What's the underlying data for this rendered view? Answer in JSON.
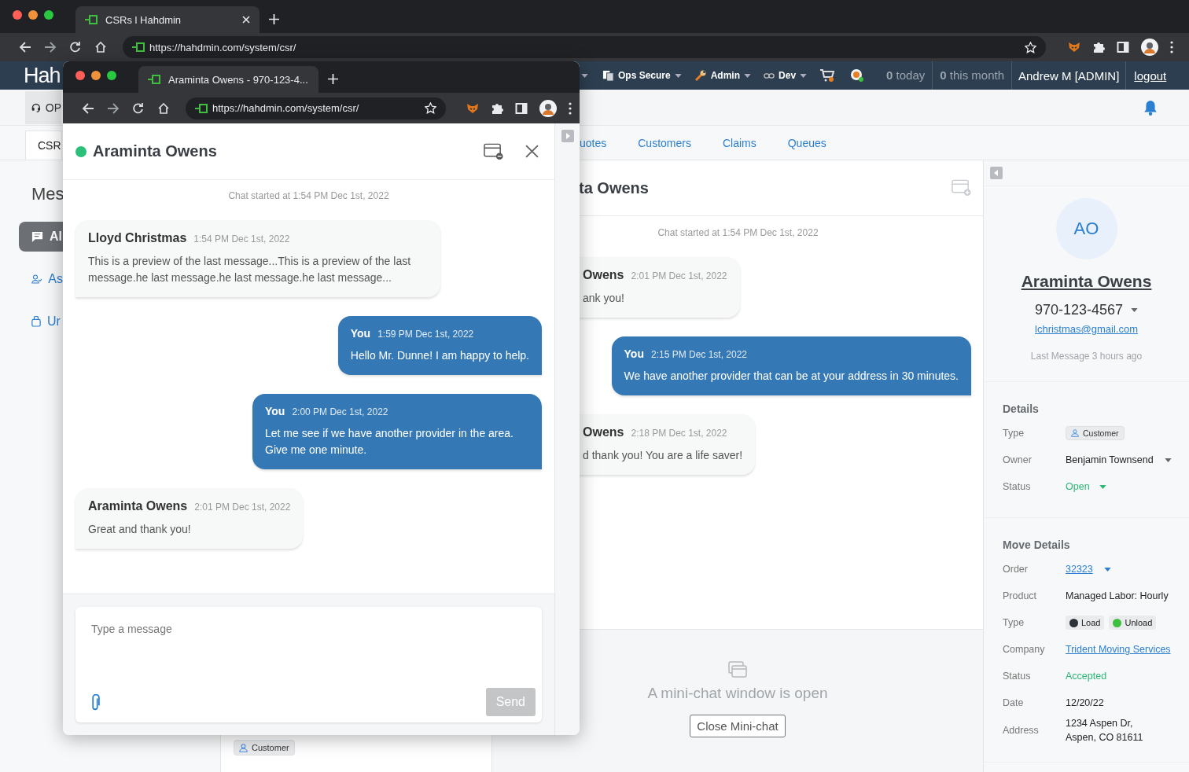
{
  "browser": {
    "tab_title": "CSRs l Hahdmin",
    "url": "https://hahdmin.com/system/csr/"
  },
  "app_header": {
    "logo": "Hah",
    "menus": [
      {
        "label": "Ops Secure",
        "kind": "documents"
      },
      {
        "label": "Admin",
        "kind": "wrench"
      },
      {
        "label": "Dev",
        "kind": "link"
      }
    ],
    "today": "**0** today",
    "month": "**0** this month",
    "user": "Andrew M [ADMIN]",
    "logout": "logout"
  },
  "toolbar": {
    "button": "OP"
  },
  "tabs": [
    {
      "label": "CSR",
      "selected": true
    },
    {
      "label": "uotes",
      "selected": false
    },
    {
      "label": "Customers",
      "selected": false
    },
    {
      "label": "Claims",
      "selected": false
    },
    {
      "label": "Queues",
      "selected": false
    }
  ],
  "sidebar": {
    "title": "Mes",
    "items": [
      {
        "label": "Al",
        "kind": "chat",
        "selected": true
      },
      {
        "label": "As",
        "kind": "person",
        "selected": false
      },
      {
        "label": "Ur",
        "kind": "bag",
        "selected": false
      }
    ]
  },
  "conversation_list": {
    "badge": "Customer"
  },
  "chat": {
    "title": "ta Owens",
    "started": "Chat started at 1:54 PM Dec 1st, 2022",
    "messages": [
      {
        "kind": "incoming",
        "author": "Owens",
        "time": "2:01 PM Dec 1st, 2022",
        "text": "ank you!"
      },
      {
        "kind": "outgoing",
        "author": "You",
        "time": "2:15 PM Dec 1st, 2022",
        "text": "We have another provider that can be at your address in 30 minutes."
      },
      {
        "kind": "incoming",
        "author": "Owens",
        "time": "2:18 PM Dec 1st, 2022",
        "text": "d thank you! You are a life saver!"
      }
    ],
    "notice": "A mini-chat window is open",
    "close_button": "Close Mini-chat"
  },
  "contact_panel": {
    "initials": "AO",
    "name": "Araminta Owens",
    "phone": "970-123-4567",
    "email": "lchristmas@gmail.com",
    "last_message": "Last Message 3 hours ago",
    "details": {
      "title": "Details",
      "rows": [
        {
          "label": "Type",
          "kind": "badge",
          "value": "Customer",
          "dropdown": false
        },
        {
          "label": "Owner",
          "kind": "text",
          "value": "Benjamin Townsend",
          "dropdown": true
        },
        {
          "label": "Status",
          "kind": "status",
          "value": "Open",
          "dropdown": true
        }
      ]
    },
    "move_details": {
      "title": "Move Details",
      "rows": [
        {
          "label": "Order",
          "kind": "link",
          "value": "32323",
          "dropdown": true
        },
        {
          "label": "Product",
          "kind": "text",
          "value": "Managed Labor: Hourly",
          "dropdown": false
        },
        {
          "label": "Type",
          "kind": "tags",
          "tags": [
            {
              "label": "Load",
              "color": "#2d3139"
            },
            {
              "label": "Unload",
              "color": "#3fbf3f"
            }
          ],
          "dropdown": false
        },
        {
          "label": "Company",
          "kind": "link",
          "value": "Trident Moving Services",
          "dropdown": false
        },
        {
          "label": "Status",
          "kind": "status",
          "value": "Accepted",
          "dropdown": false
        },
        {
          "label": "Date",
          "kind": "text",
          "value": "12/20/22",
          "dropdown": false
        },
        {
          "label": "Address",
          "kind": "lines",
          "lines": [
            "1234 Aspen Dr,",
            "Aspen, CO 81611"
          ],
          "dropdown": false
        }
      ]
    }
  },
  "mini_chat": {
    "tab_title": "Araminta Owens - 970-123-4...",
    "url": "https://hahdmin.com/system/csr/",
    "title": "Araminta Owens",
    "online": true,
    "started": "Chat started at 1:54 PM Dec 1st, 2022",
    "messages": [
      {
        "kind": "incoming",
        "author": "Lloyd Christmas",
        "time": "1:54 PM Dec 1st, 2022",
        "text": "This is a preview of the last message...This is a preview of the last message.he last message.he last message.he last message..."
      },
      {
        "kind": "outgoing",
        "author": "You",
        "time": "1:59 PM Dec 1st, 2022",
        "text": "Hello Mr. Dunne! I am happy to help."
      },
      {
        "kind": "outgoing",
        "author": "You",
        "time": "2:00 PM Dec 1st, 2022",
        "text": "Let me see if we have another provider in the area. Give me one minute."
      },
      {
        "kind": "incoming",
        "author": "Araminta Owens",
        "time": "2:01 PM Dec 1st, 2022",
        "text": "Great and thank you!"
      }
    ],
    "composer": {
      "placeholder": "Type a message",
      "send": "Send",
      "send_disabled": true
    }
  }
}
